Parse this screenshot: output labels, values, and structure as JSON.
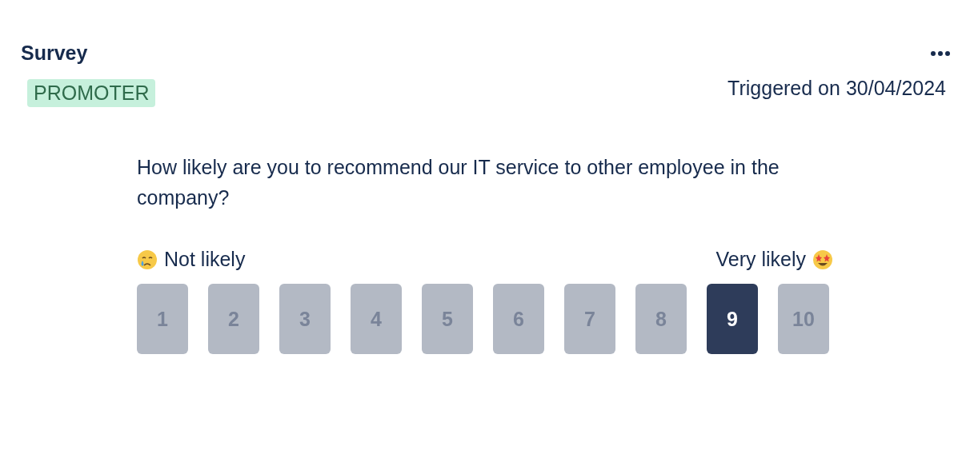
{
  "header": {
    "title": "Survey",
    "badge": "PROMOTER",
    "triggered": "Triggered on 30/04/2024"
  },
  "question": "How likely are you to recommend our IT service to other employee in the company?",
  "scale": {
    "low_label": "Not likely",
    "high_label": "Very likely",
    "options": [
      {
        "label": "1",
        "selected": false
      },
      {
        "label": "2",
        "selected": false
      },
      {
        "label": "3",
        "selected": false
      },
      {
        "label": "4",
        "selected": false
      },
      {
        "label": "5",
        "selected": false
      },
      {
        "label": "6",
        "selected": false
      },
      {
        "label": "7",
        "selected": false
      },
      {
        "label": "8",
        "selected": false
      },
      {
        "label": "9",
        "selected": true
      },
      {
        "label": "10",
        "selected": false
      }
    ]
  }
}
